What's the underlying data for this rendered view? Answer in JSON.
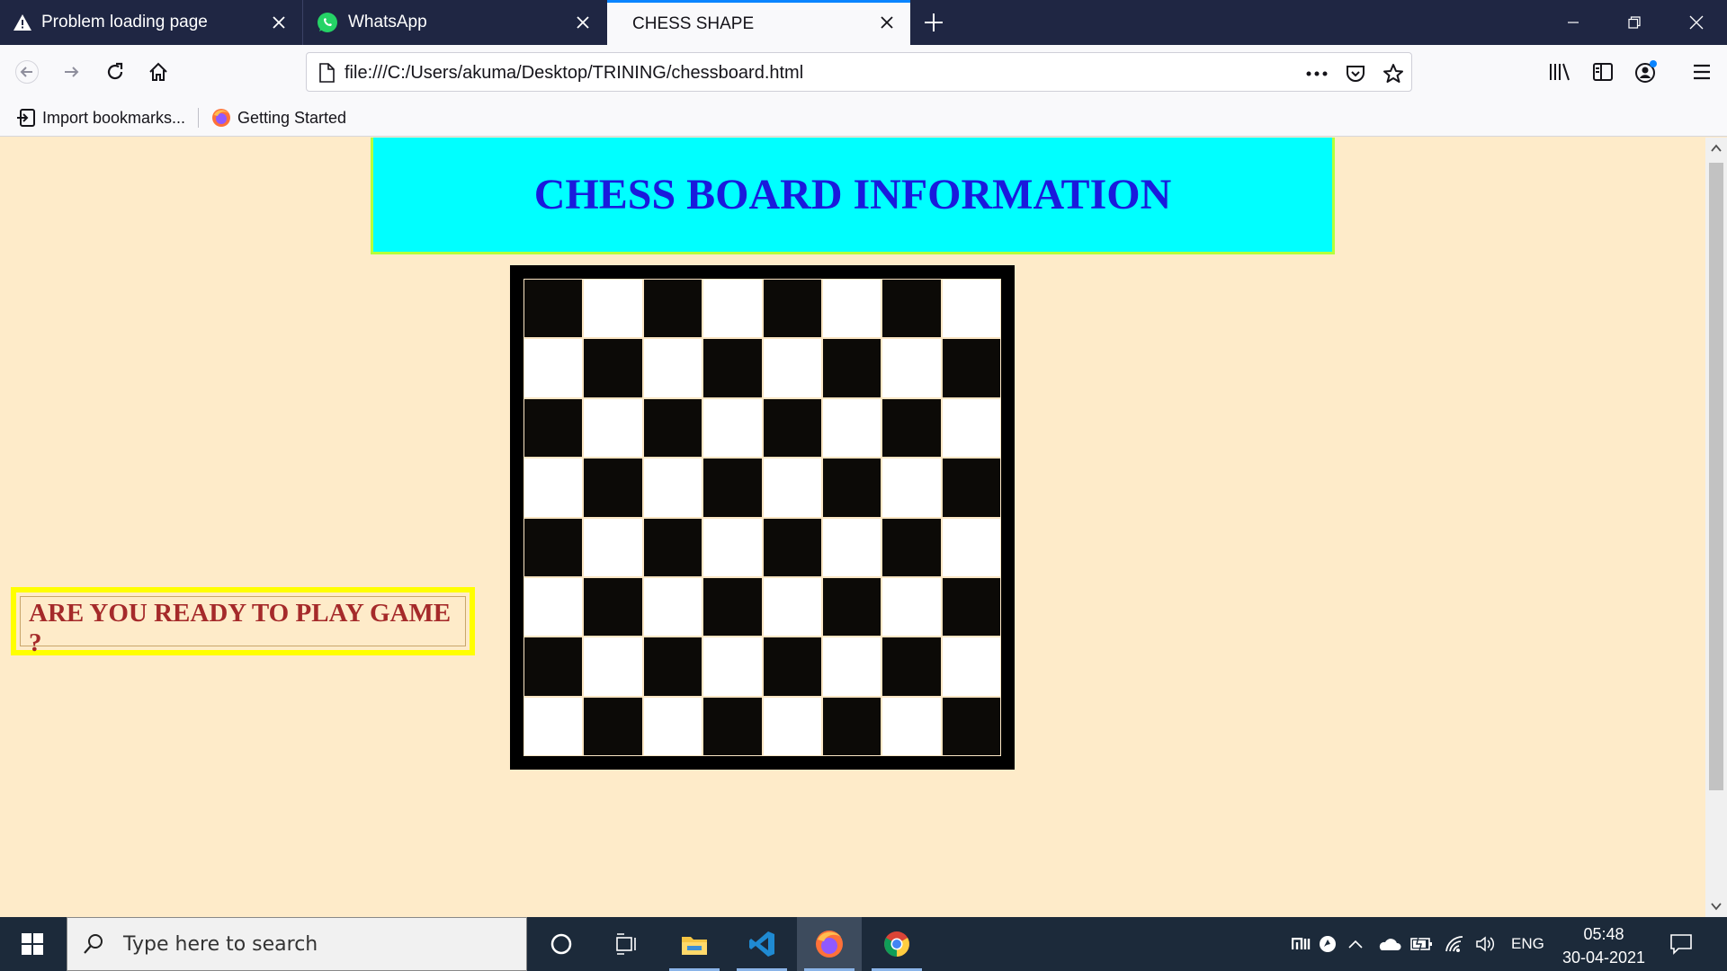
{
  "browser": {
    "tabs": [
      {
        "title": "Problem loading page",
        "icon": "warning-icon",
        "active": false
      },
      {
        "title": "WhatsApp",
        "icon": "whatsapp-icon",
        "active": false
      },
      {
        "title": "CHESS SHAPE",
        "icon": "",
        "active": true
      }
    ],
    "url": "file:///C:/Users/akuma/Desktop/TRINING/chessboard.html",
    "bookmarks": [
      {
        "label": "Import bookmarks...",
        "icon": "import-icon"
      },
      {
        "label": "Getting Started",
        "icon": "firefox-icon"
      }
    ],
    "accent_color": "#0a84ff"
  },
  "page": {
    "heading": "CHESS BOARD INFORMATION",
    "ready_text": "ARE YOU READY TO PLAY GAME ?",
    "colors": {
      "background": "#feebc9",
      "header_bg": "#00ffff",
      "header_text": "#1a1adc",
      "ready_text": "#a52a2a",
      "ready_border": "#ffff00",
      "board_border": "#000000",
      "dark_square": "#0c0a07",
      "light_square": "#ffffff"
    },
    "board": {
      "rows": 8,
      "cols": 8,
      "top_left": "dark"
    }
  },
  "taskbar": {
    "search_placeholder": "Type here to search",
    "apps": [
      "cortana-icon",
      "task-view-icon",
      "file-explorer-icon",
      "vscode-icon",
      "firefox-icon",
      "chrome-icon"
    ],
    "active_app": "firefox-icon",
    "language": "ENG",
    "time": "05:48",
    "date": "30-04-2021"
  }
}
